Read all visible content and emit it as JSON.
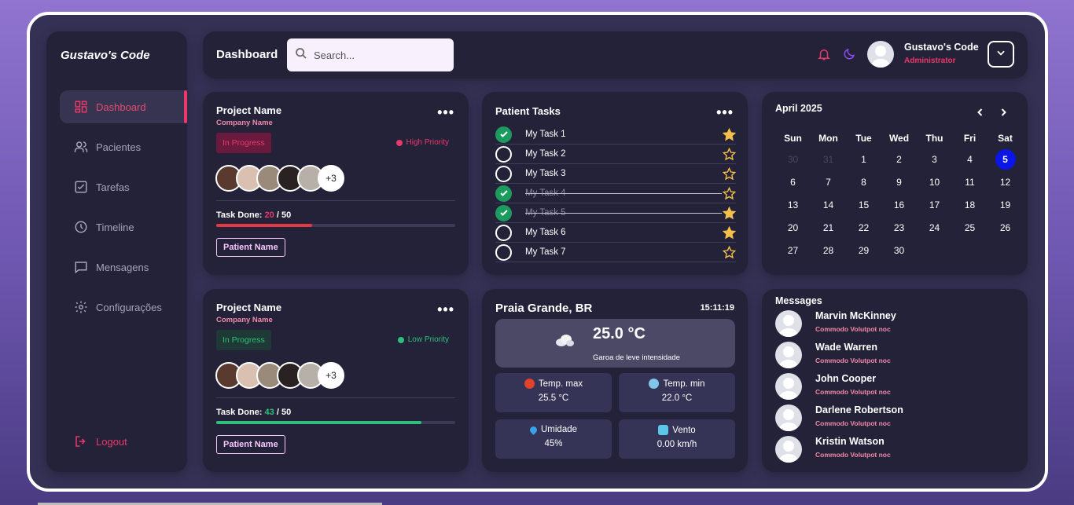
{
  "brand": "Gustavo's Code",
  "sidebar": {
    "items": [
      {
        "label": "Dashboard",
        "icon": "dashboard-icon",
        "active": true
      },
      {
        "label": "Pacientes",
        "icon": "users-icon"
      },
      {
        "label": "Tarefas",
        "icon": "checkbox-icon"
      },
      {
        "label": "Timeline",
        "icon": "clock-icon"
      },
      {
        "label": "Mensagens",
        "icon": "message-icon"
      },
      {
        "label": "Configurações",
        "icon": "gear-icon"
      }
    ],
    "logout": "Logout"
  },
  "header": {
    "title": "Dashboard",
    "search_placeholder": "Search...",
    "user_name": "Gustavo's Code",
    "user_role": "Administrator"
  },
  "projects": [
    {
      "title": "Project Name",
      "company": "Company Name",
      "status": "In Progress",
      "priority": "High Priority",
      "extra_members": "+3",
      "task_label": "Task Done:",
      "done": "20",
      "total": "/ 50",
      "progress": 0.4,
      "button": "Patient Name",
      "accent": "#e8396b"
    },
    {
      "title": "Project Name",
      "company": "Company Name",
      "status": "In Progress",
      "priority": "Low Priority",
      "extra_members": "+3",
      "task_label": "Task Done:",
      "done": "43",
      "total": "/ 50",
      "progress": 0.86,
      "button": "Patient Name",
      "accent": "#2fbf7a"
    }
  ],
  "tasks": {
    "title": "Patient Tasks",
    "items": [
      {
        "label": "My Task 1",
        "done": true,
        "starred": true,
        "struck": false
      },
      {
        "label": "My Task 2",
        "done": false,
        "starred": false,
        "struck": false
      },
      {
        "label": "My Task 3",
        "done": false,
        "starred": false,
        "struck": false
      },
      {
        "label": "My Task 4",
        "done": true,
        "starred": false,
        "struck": true
      },
      {
        "label": "My Task 5",
        "done": true,
        "starred": true,
        "struck": true
      },
      {
        "label": "My Task 6",
        "done": false,
        "starred": true,
        "struck": false
      },
      {
        "label": "My Task 7",
        "done": false,
        "starred": false,
        "struck": false
      }
    ]
  },
  "calendar": {
    "title": "April 2025",
    "weekdays": [
      "Sun",
      "Mon",
      "Tue",
      "Wed",
      "Thu",
      "Fri",
      "Sat"
    ],
    "leading_days": [
      "30",
      "31"
    ],
    "days": 30,
    "today": 5
  },
  "weather": {
    "city": "Praia Grande, BR",
    "time": "15:11:19",
    "temp": "25.0 °C",
    "description": "Garoa de leve intensidade",
    "stats": [
      {
        "label": "Temp. max",
        "value": "25.5 °C",
        "icon": "hot-face-icon",
        "color": "#e0422b"
      },
      {
        "label": "Temp. min",
        "value": "22.0 °C",
        "icon": "cold-face-icon",
        "color": "#7fc6e8"
      },
      {
        "label": "Umidade",
        "value": "45%",
        "icon": "droplet-icon",
        "color": "#3aa2e8"
      },
      {
        "label": "Vento",
        "value": "0.00 km/h",
        "icon": "wind-icon",
        "color": "#5cc6e8"
      }
    ]
  },
  "messages": {
    "title": "Messages",
    "items": [
      {
        "name": "Marvin McKinney",
        "text": "Commodo Volutpot noc"
      },
      {
        "name": "Wade Warren",
        "text": "Commodo Volutpot noc"
      },
      {
        "name": "John Cooper",
        "text": "Commodo Volutpot noc"
      },
      {
        "name": "Darlene Robertson",
        "text": "Commodo Volutpot noc"
      },
      {
        "name": "Kristin Watson",
        "text": "Commodo Volutpot noc"
      }
    ]
  }
}
